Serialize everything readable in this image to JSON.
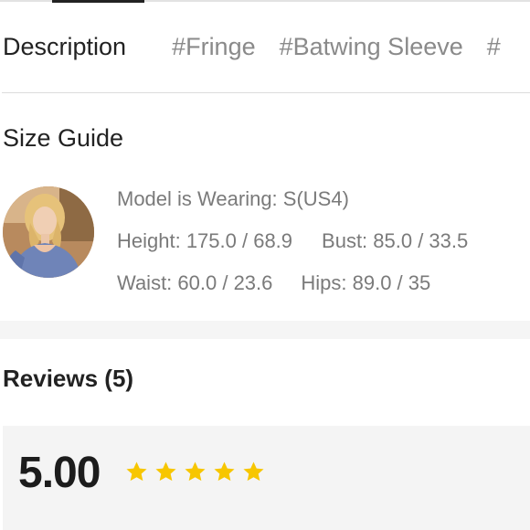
{
  "tabs": {
    "description_label": "Description",
    "tags": [
      "#Fringe",
      "#Batwing Sleeve",
      "#"
    ]
  },
  "size_guide": {
    "title": "Size Guide",
    "model_wearing": "Model is Wearing: S(US4)",
    "height": "Height: 175.0 / 68.9",
    "bust": "Bust: 85.0 / 33.5",
    "waist": "Waist: 60.0 / 23.6",
    "hips": "Hips: 89.0 / 35"
  },
  "reviews": {
    "title": "Reviews (5)",
    "average_rating": "5.00",
    "stars_filled": 5,
    "stars_total": 5,
    "star_color": "#f7c600"
  },
  "colors": {
    "text_primary": "#222222",
    "text_secondary": "#7a7a7a",
    "tag_text": "#8a8a8a",
    "panel_background": "#f4f4f4"
  }
}
